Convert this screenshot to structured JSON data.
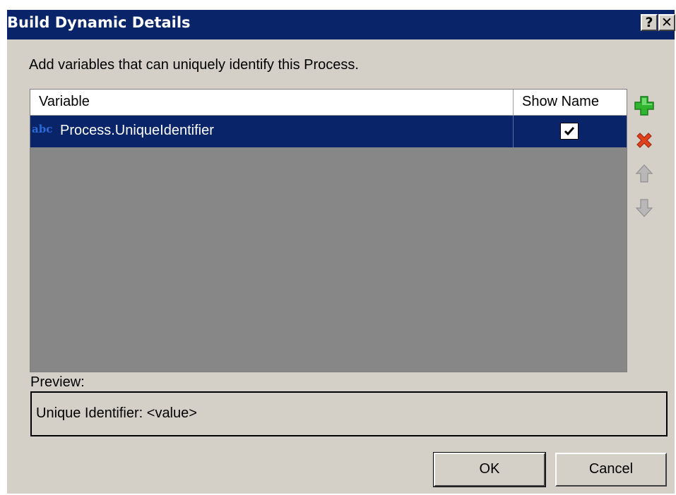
{
  "dialog": {
    "title": "Build Dynamic Details",
    "help_label": "?",
    "close_label": "✕",
    "instruction": "Add variables that can uniquely identify this Process.",
    "grid": {
      "columns": [
        "Variable",
        "Show Name"
      ],
      "rows": [
        {
          "type_badge": "abc",
          "variable": "Process.UniqueIdentifier",
          "show_name": true
        }
      ]
    },
    "side_buttons": [
      "add-icon",
      "remove-icon",
      "move-up-icon",
      "move-down-icon"
    ],
    "preview_label": "Preview:",
    "preview_text": "Unique Identifier: <value>",
    "ok_label": "OK",
    "cancel_label": "Cancel"
  },
  "colors": {
    "titlebar": "#0a246a",
    "selected_row": "#0a246a",
    "grid_background": "#878787",
    "dialog_background": "#d4d0c8",
    "add_icon": "#2fb52f",
    "remove_icon": "#e0401c"
  }
}
